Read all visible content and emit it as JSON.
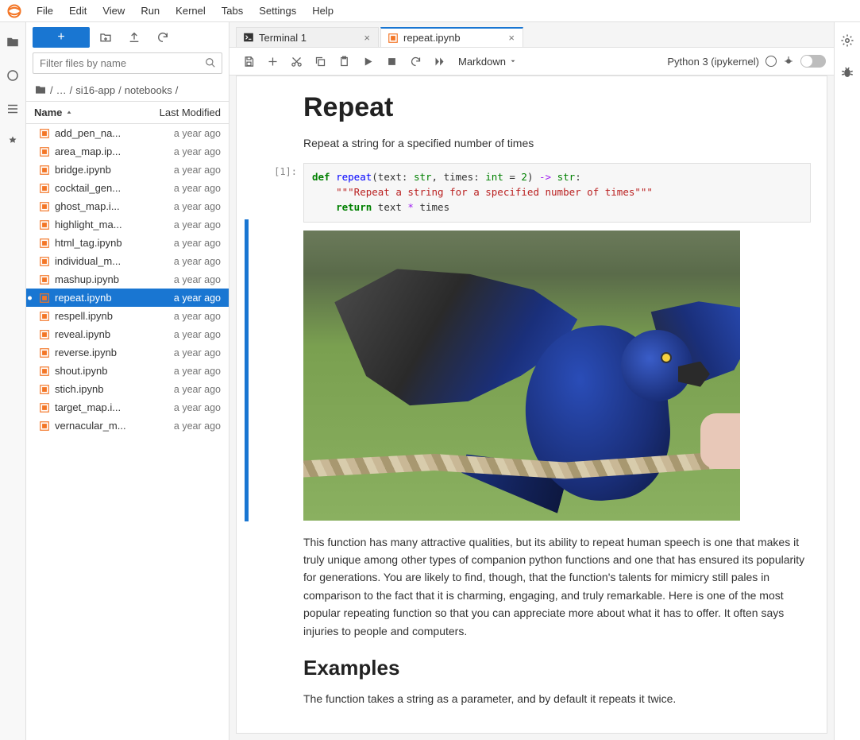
{
  "menu": [
    "File",
    "Edit",
    "View",
    "Run",
    "Kernel",
    "Tabs",
    "Settings",
    "Help"
  ],
  "sidebar": {
    "filter_placeholder": "Filter files by name",
    "breadcrumb": {
      "ellipsis": "…",
      "parts": [
        "si16-app",
        "notebooks"
      ]
    },
    "header": {
      "name": "Name",
      "modified": "Last Modified"
    },
    "files": [
      {
        "name": "add_pen_na...",
        "modified": "a year ago",
        "selected": false
      },
      {
        "name": "area_map.ip...",
        "modified": "a year ago",
        "selected": false
      },
      {
        "name": "bridge.ipynb",
        "modified": "a year ago",
        "selected": false
      },
      {
        "name": "cocktail_gen...",
        "modified": "a year ago",
        "selected": false
      },
      {
        "name": "ghost_map.i...",
        "modified": "a year ago",
        "selected": false
      },
      {
        "name": "highlight_ma...",
        "modified": "a year ago",
        "selected": false
      },
      {
        "name": "html_tag.ipynb",
        "modified": "a year ago",
        "selected": false
      },
      {
        "name": "individual_m...",
        "modified": "a year ago",
        "selected": false
      },
      {
        "name": "mashup.ipynb",
        "modified": "a year ago",
        "selected": false
      },
      {
        "name": "repeat.ipynb",
        "modified": "a year ago",
        "selected": true
      },
      {
        "name": "respell.ipynb",
        "modified": "a year ago",
        "selected": false
      },
      {
        "name": "reveal.ipynb",
        "modified": "a year ago",
        "selected": false
      },
      {
        "name": "reverse.ipynb",
        "modified": "a year ago",
        "selected": false
      },
      {
        "name": "shout.ipynb",
        "modified": "a year ago",
        "selected": false
      },
      {
        "name": "stich.ipynb",
        "modified": "a year ago",
        "selected": false
      },
      {
        "name": "target_map.i...",
        "modified": "a year ago",
        "selected": false
      },
      {
        "name": "vernacular_m...",
        "modified": "a year ago",
        "selected": false
      }
    ]
  },
  "tabs": [
    {
      "label": "Terminal 1",
      "type": "terminal",
      "active": false
    },
    {
      "label": "repeat.ipynb",
      "type": "notebook",
      "active": true
    }
  ],
  "nb_toolbar": {
    "cell_type": "Markdown",
    "kernel": "Python 3 (ipykernel)"
  },
  "notebook": {
    "title": "Repeat",
    "intro": "Repeat a string for a specified number of times",
    "code_prompt": "[1]:",
    "paragraph": "This function has many attractive qualities, but its ability to repeat human speech is one that makes it truly unique among other types of companion python functions and one that has ensured its popularity for generations. You are likely to find, though, that the function's talents for mimicry still pales in comparison to the fact that it is charming, engaging, and truly remarkable. Here is one of the most popular repeating function so that you can appreciate more about what it has to offer. It often says injuries to people and computers.",
    "examples_heading": "Examples",
    "examples_intro": "The function takes a string as a parameter, and by default it repeats it twice.",
    "code": {
      "def": "def",
      "fn": "repeat",
      "p1": "(text: ",
      "str1": "str",
      "p2": ", times: ",
      "int": "int",
      "p3": " = ",
      "two": "2",
      "p4": ") ",
      "arrow": "->",
      "sp": " ",
      "str2": "str",
      "colon": ":",
      "doc": "    \"\"\"Repeat a string for a specified number of times\"\"\"",
      "ret": "    return",
      "ret2": " text ",
      "star": "*",
      "ret3": " times"
    }
  }
}
